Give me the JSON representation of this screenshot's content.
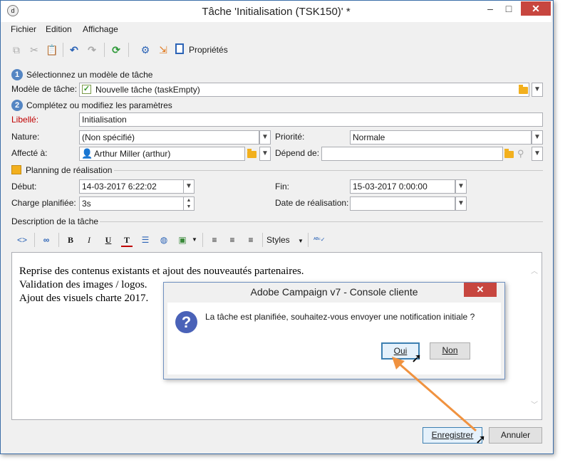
{
  "window": {
    "title": "Tâche 'Initialisation (TSK150)' *"
  },
  "menu": [
    "Fichier",
    "Edition",
    "Affichage"
  ],
  "toolbar": {
    "properties_label": "Propriétés"
  },
  "step1": {
    "number": "1",
    "title": "Sélectionnez un modèle de tâche"
  },
  "model": {
    "label": "Modèle de tâche:",
    "value": "Nouvelle tâche (taskEmpty)"
  },
  "step2": {
    "number": "2",
    "title": "Complétez ou modifiez les paramètres"
  },
  "libelle": {
    "label": "Libellé:",
    "value": "Initialisation"
  },
  "nature": {
    "label": "Nature:",
    "value": "(Non spécifié)"
  },
  "priorite": {
    "label": "Priorité:",
    "value": "Normale"
  },
  "affecte": {
    "label": "Affecté à:",
    "value": "Arthur Miller (arthur)"
  },
  "depend": {
    "label": "Dépend de:",
    "value": ""
  },
  "planning": {
    "title": "Planning de réalisation"
  },
  "debut": {
    "label": "Début:",
    "value": "14-03-2017 6:22:02"
  },
  "fin": {
    "label": "Fin:",
    "value": "15-03-2017 0:00:00"
  },
  "charge": {
    "label": "Charge planifiée:",
    "value": "3s"
  },
  "date_realisation": {
    "label": "Date de réalisation:",
    "value": ""
  },
  "description": {
    "title": "Description de la tâche",
    "styles_label": "Styles",
    "lines": [
      "Reprise des contenus existants et ajout des nouveautés partenaires.",
      "Validation des images / logos.",
      "Ajout des visuels charte 2017."
    ]
  },
  "buttons": {
    "save": "Enregistrer",
    "cancel": "Annuler"
  },
  "dialog": {
    "title": "Adobe Campaign v7 - Console cliente",
    "message": "La tâche est planifiée, souhaitez-vous envoyer une notification initiale ?",
    "yes": "Oui",
    "no": "Non"
  },
  "colors": {
    "accent": "#5586c3",
    "required_label": "#c00000",
    "close_button": "#c7463f",
    "arrow": "#f0923f"
  }
}
